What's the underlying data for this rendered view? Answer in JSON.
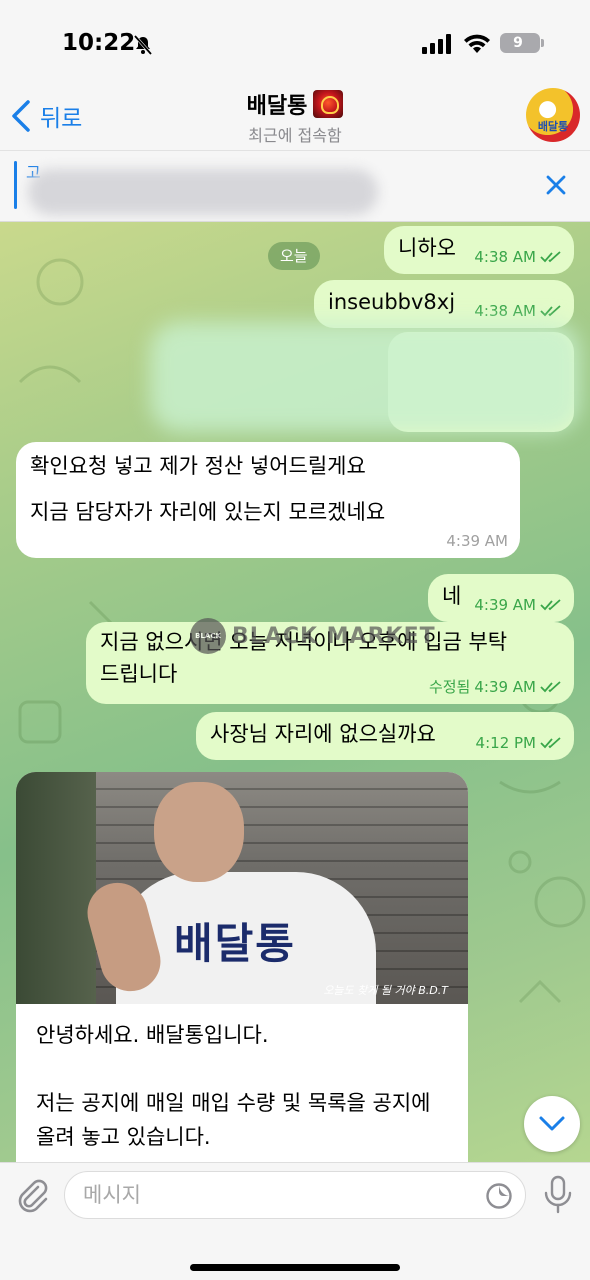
{
  "status_bar": {
    "time": "10:22",
    "battery": "9"
  },
  "header": {
    "back_label": "뒤로",
    "title": "배달통",
    "subtitle": "최근에 접속함",
    "avatar_text": "배달통"
  },
  "pinned": {
    "title": "고"
  },
  "chat": {
    "date_pill": "오늘",
    "messages": [
      {
        "text": "니하오",
        "time": "4:38 AM"
      },
      {
        "text": "inseubbv8xj",
        "time": "4:38 AM"
      },
      {
        "text": "확인요청 넣고 제가 정산 넣어드릴게요",
        "text2": "지금 담당자가 자리에 있는지 모르겠네요",
        "time": "4:39 AM"
      },
      {
        "text": "네",
        "time": "4:39 AM"
      },
      {
        "text": "지금 없으시면 오늘 저녁이나 오후에 입금 부탁",
        "text2": "드립니다",
        "edited": "수정됨",
        "time": "4:39 AM"
      },
      {
        "text": "사장님 자리에 없으실까요",
        "time": "4:12 PM"
      }
    ],
    "media": {
      "shirt_text": "배달통",
      "caption": "오늘도 찾게 될 거야 B.D.T",
      "para1": "안녕하세요. 배달통입니다.",
      "para2": "저는 공지에 매일 매입 수량 및 목록을 공지에 올려 놓고 있습니다."
    },
    "watermark": "BLACK MARKET",
    "watermark_badge": "BLACK"
  },
  "input": {
    "placeholder": "메시지"
  },
  "colors": {
    "accent": "#1a7fe8",
    "outgoing": "#e3fbc9",
    "incoming": "#ffffff",
    "check": "#3aa64a"
  }
}
